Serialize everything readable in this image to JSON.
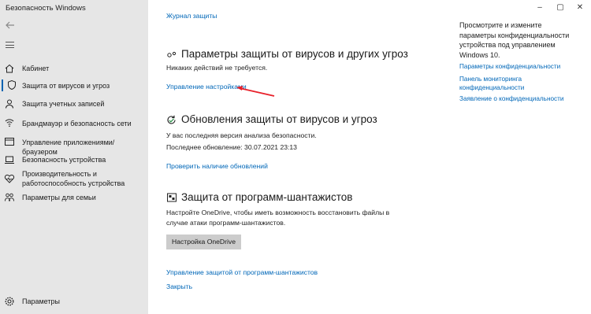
{
  "window": {
    "title": "Безопасность Windows",
    "minimize": "–",
    "maximize": "▢",
    "close": "✕"
  },
  "sidebar": {
    "back_icon": "back-arrow-icon",
    "menu_icon": "hamburger-icon",
    "items": [
      {
        "label": "Кабинет",
        "icon": "home-icon"
      },
      {
        "label": "Защита от вирусов и угроз",
        "icon": "shield-icon",
        "active": true
      },
      {
        "label": "Защита учетных записей",
        "icon": "person-icon"
      },
      {
        "label": "Брандмауэр и безопасность сети",
        "icon": "wifi-icon"
      },
      {
        "label": "Управление приложениями/браузером",
        "icon": "app-window-icon"
      },
      {
        "label": "Безопасность устройства",
        "icon": "laptop-icon"
      },
      {
        "label_line1": "Производительность и",
        "label_line2": "работоспособность устройства",
        "icon": "heart-icon"
      },
      {
        "label": "Параметры для семьи",
        "icon": "family-icon"
      }
    ],
    "settings": {
      "label": "Параметры",
      "icon": "gear-icon"
    }
  },
  "main": {
    "top_link": "Журнал защиты",
    "virus_settings": {
      "title": "Параметры защиты от вирусов и других угроз",
      "status": "Никаких действий не требуется.",
      "link": "Управление настройками"
    },
    "updates": {
      "title": "Обновления защиты от вирусов и угроз",
      "line1": "У вас последняя версия анализа безопасности.",
      "line2": "Последнее обновление: 30.07.2021 23:13",
      "link": "Проверить наличие обновлений"
    },
    "ransomware": {
      "title": "Защита от программ-шантажистов",
      "line1": "Настройте OneDrive, чтобы иметь возможность восстановить файлы в",
      "line2": "случае атаки программ-шантажистов.",
      "button": "Настройка OneDrive",
      "link_manage": "Управление защитой от программ-шантажистов",
      "link_close": "Закрыть"
    }
  },
  "right_panel": {
    "description": "Просмотрите и измените параметры конфиденциальности устройства под управлением Windows 10.",
    "links": [
      "Параметры конфиденциальности",
      "Панель мониторинга конфиденциальности",
      "Заявление о конфиденциальности"
    ]
  },
  "colors": {
    "accent": "#0067b8",
    "annotation_arrow": "#e8202a",
    "sidebar_bg": "#e6e6e6"
  }
}
